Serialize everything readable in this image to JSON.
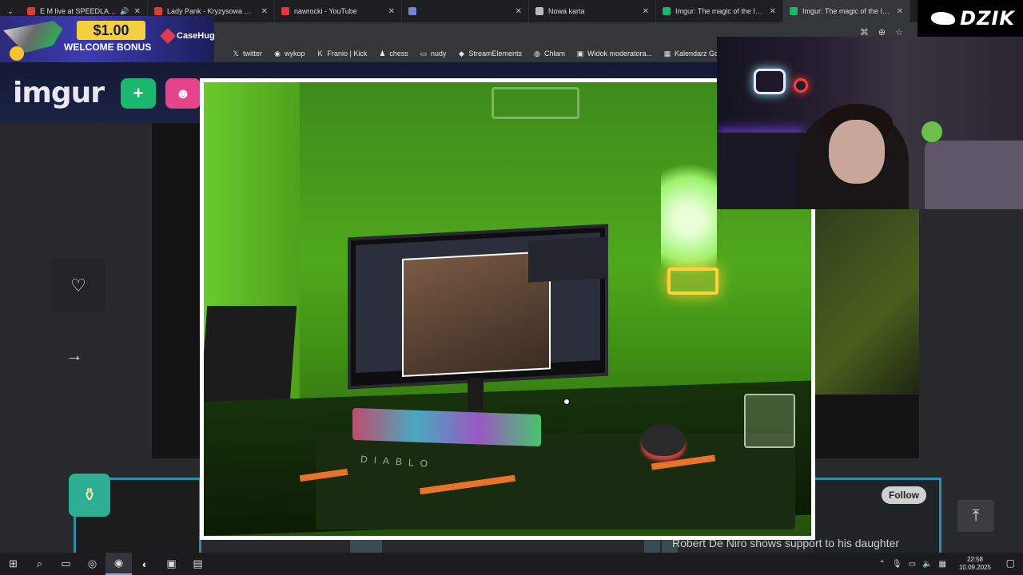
{
  "browser": {
    "tabs": [
      {
        "title": "E M live at SPEEDLAND",
        "favicon_color": "#e53935",
        "audio": true,
        "active": false
      },
      {
        "title": "Lady Pank - Kryzysowa Narzeczona",
        "favicon_color": "#e53935",
        "audio": false,
        "active": false
      },
      {
        "title": "nawrocki - YouTube",
        "favicon_color": "#e53935",
        "audio": false,
        "active": false
      },
      {
        "title": "",
        "favicon_color": "#6a8ad8",
        "audio": false,
        "active": false
      },
      {
        "title": "Nowa karta",
        "favicon_color": "#bbbbbb",
        "audio": false,
        "active": false
      },
      {
        "title": "Imgur: The magic of the Internet",
        "favicon_color": "#1bb76e",
        "audio": false,
        "active": false
      },
      {
        "title": "Imgur: The magic of the Internet",
        "favicon_color": "#1bb76e",
        "audio": false,
        "active": true
      }
    ],
    "new_tab_label": "+",
    "bookmarks": [
      {
        "label": "twitter",
        "icon": "x-icon"
      },
      {
        "label": "wykop",
        "icon": "wykop-icon"
      },
      {
        "label": "Franio | Kick",
        "icon": "kick-icon"
      },
      {
        "label": "chess",
        "icon": "pawn-icon"
      },
      {
        "label": "nudy",
        "icon": "folder-icon"
      },
      {
        "label": "StreamElements",
        "icon": "streamelements-icon"
      },
      {
        "label": "Chłam",
        "icon": "globe-icon"
      },
      {
        "label": "Widok moderatora...",
        "icon": "twitch-icon"
      },
      {
        "label": "Kalendarz Google -...",
        "icon": "calendar-icon"
      }
    ]
  },
  "imgur": {
    "logo": "imgur",
    "new_post_symbol": "+",
    "follow_label": "Follow",
    "story_title": "Robert De Niro shows support to his daughter",
    "heart_symbol": "♡",
    "share_symbol": "→",
    "scroll_top_symbol": "⤒"
  },
  "overlays": {
    "casehug": {
      "amount": "$1.00",
      "bonus": "WELCOME BONUS",
      "brand": "CaseHug"
    },
    "dzik": {
      "text": "DZIK"
    }
  },
  "photo": {
    "mat_text": "DIABLO"
  },
  "taskbar": {
    "time": "22:58",
    "date": "10.09.2025"
  }
}
